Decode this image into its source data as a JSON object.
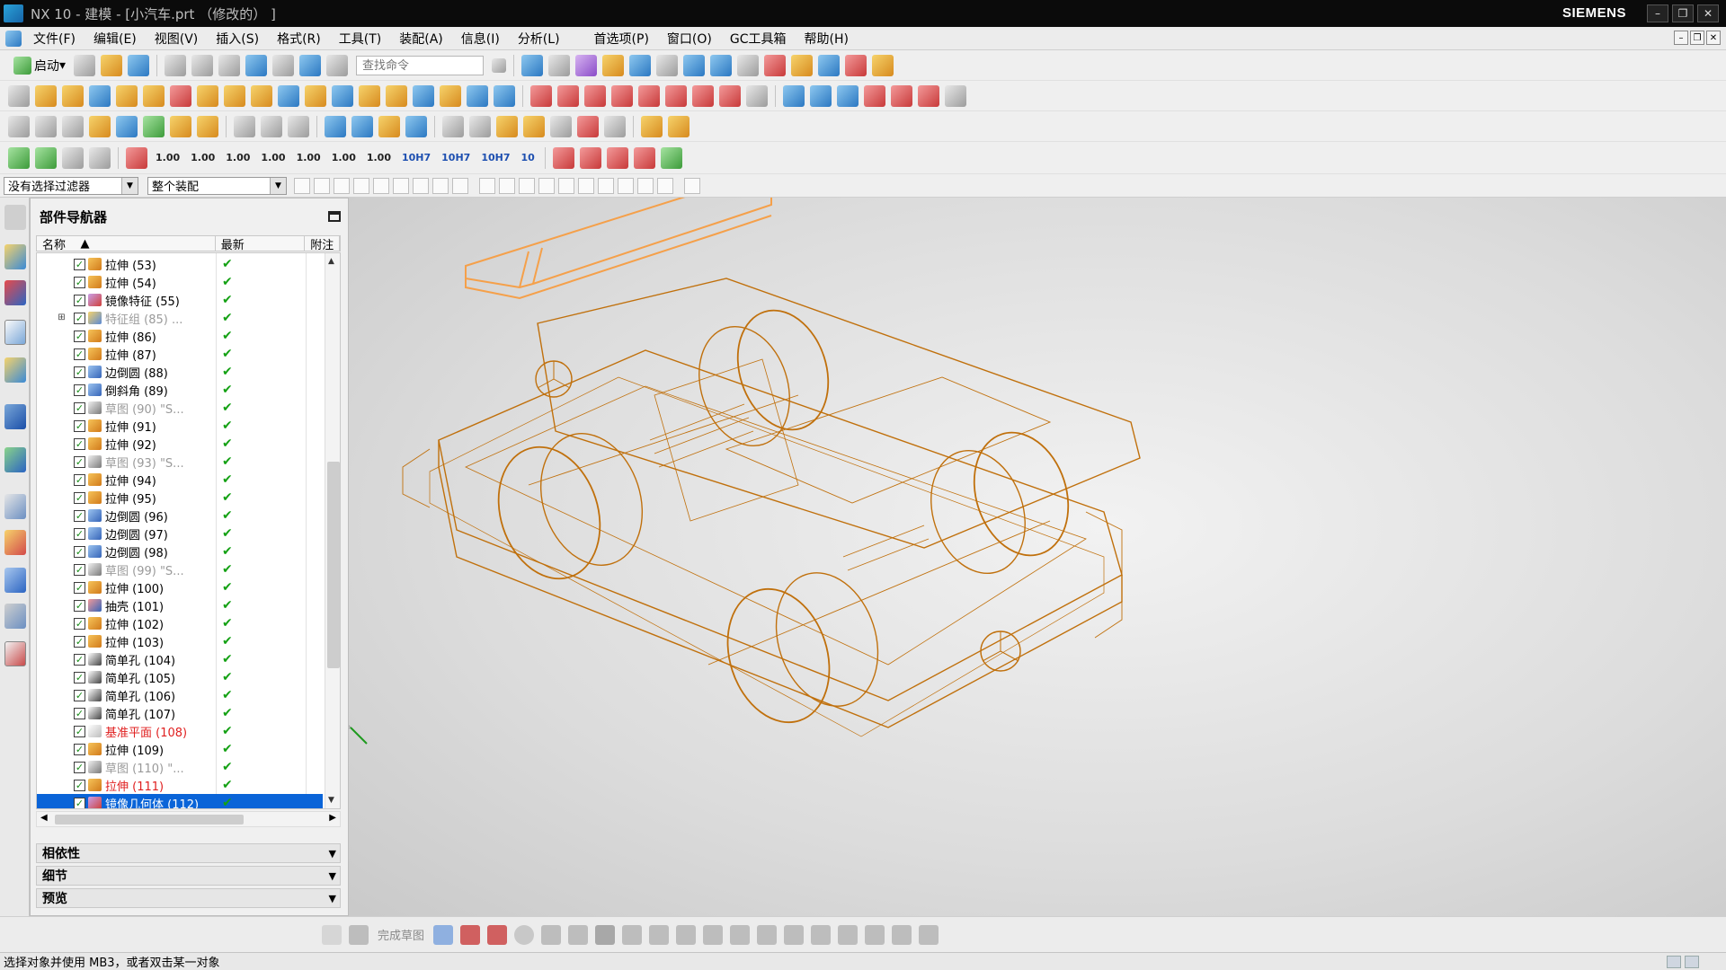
{
  "window": {
    "title": "NX 10 - 建模 - [小汽车.prt （修改的） ]",
    "brand": "SIEMENS"
  },
  "menu": [
    "文件(F)",
    "编辑(E)",
    "视图(V)",
    "插入(S)",
    "格式(R)",
    "工具(T)",
    "装配(A)",
    "信息(I)",
    "分析(L)",
    "首选项(P)",
    "窗口(O)",
    "GC工具箱",
    "帮助(H)"
  ],
  "toolbar": {
    "launch_label": "启动",
    "search_placeholder": "查找命令"
  },
  "pmi_numbers": [
    "1.00",
    "1.00",
    "1.00",
    "1.00",
    "1.00",
    "1.00",
    "1.00",
    "10H7",
    "10H7",
    "10H7",
    "10"
  ],
  "filter": {
    "selection_filter": "没有选择过滤器",
    "scope": "整个装配"
  },
  "navigator": {
    "title": "部件导航器",
    "columns": {
      "name": "名称",
      "latest": "最新",
      "note": "附注"
    },
    "rows": [
      {
        "label": "拉伸 (53)",
        "kind": "extrude",
        "state": "normal"
      },
      {
        "label": "拉伸 (54)",
        "kind": "extrude",
        "state": "normal"
      },
      {
        "label": "镜像特征 (55)",
        "kind": "mirror",
        "state": "normal"
      },
      {
        "label": "特征组 (85) ...",
        "kind": "group",
        "state": "dim",
        "expand": "+"
      },
      {
        "label": "拉伸 (86)",
        "kind": "extrude",
        "state": "normal"
      },
      {
        "label": "拉伸 (87)",
        "kind": "extrude",
        "state": "normal"
      },
      {
        "label": "边倒圆 (88)",
        "kind": "blend",
        "state": "normal"
      },
      {
        "label": "倒斜角 (89)",
        "kind": "chamfer",
        "state": "normal"
      },
      {
        "label": "草图 (90) \"S...",
        "kind": "sketch",
        "state": "dim"
      },
      {
        "label": "拉伸 (91)",
        "kind": "extrude",
        "state": "normal"
      },
      {
        "label": "拉伸 (92)",
        "kind": "extrude",
        "state": "normal"
      },
      {
        "label": "草图 (93) \"S...",
        "kind": "sketch",
        "state": "dim"
      },
      {
        "label": "拉伸 (94)",
        "kind": "extrude",
        "state": "normal"
      },
      {
        "label": "拉伸 (95)",
        "kind": "extrude",
        "state": "normal"
      },
      {
        "label": "边倒圆 (96)",
        "kind": "blend",
        "state": "normal"
      },
      {
        "label": "边倒圆 (97)",
        "kind": "blend",
        "state": "normal"
      },
      {
        "label": "边倒圆 (98)",
        "kind": "blend",
        "state": "normal"
      },
      {
        "label": "草图 (99) \"S...",
        "kind": "sketch",
        "state": "dim"
      },
      {
        "label": "拉伸 (100)",
        "kind": "extrude",
        "state": "normal"
      },
      {
        "label": "抽壳 (101)",
        "kind": "shell",
        "state": "normal"
      },
      {
        "label": "拉伸 (102)",
        "kind": "extrude",
        "state": "normal"
      },
      {
        "label": "拉伸 (103)",
        "kind": "extrude",
        "state": "normal"
      },
      {
        "label": "简单孔 (104)",
        "kind": "hole",
        "state": "normal"
      },
      {
        "label": "简单孔 (105)",
        "kind": "hole",
        "state": "normal"
      },
      {
        "label": "简单孔 (106)",
        "kind": "hole",
        "state": "normal"
      },
      {
        "label": "简单孔 (107)",
        "kind": "hole",
        "state": "normal"
      },
      {
        "label": "基准平面 (108)",
        "kind": "datum",
        "state": "red"
      },
      {
        "label": "拉伸 (109)",
        "kind": "extrude",
        "state": "normal"
      },
      {
        "label": "草图 (110) \"...",
        "kind": "sketch",
        "state": "dim"
      },
      {
        "label": "拉伸 (111)",
        "kind": "extrude",
        "state": "red"
      },
      {
        "label": "镜像几何体 (112)",
        "kind": "mirror",
        "state": "selected"
      }
    ],
    "panels": [
      "相依性",
      "细节",
      "预览"
    ]
  },
  "bottom_toolbar": {
    "finish_sketch": "完成草图"
  },
  "status": "选择对象并使用 MB3，或者双击某一对象",
  "colors": {
    "model": "#c0700c",
    "highlight": "#f5a04a",
    "selection": "#0a64d8"
  }
}
